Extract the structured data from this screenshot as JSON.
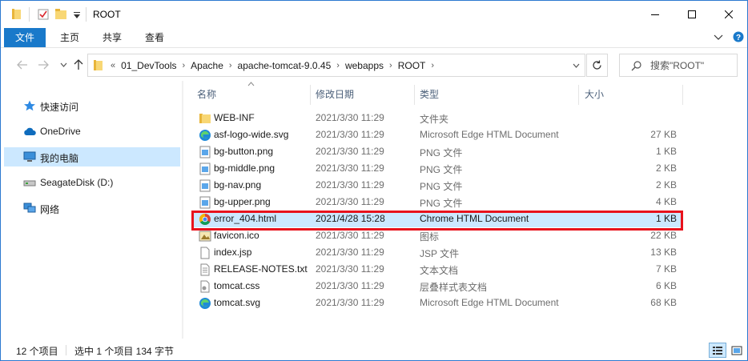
{
  "window": {
    "title": "ROOT"
  },
  "ribbon": {
    "tabs": [
      "文件",
      "主页",
      "共享",
      "查看"
    ]
  },
  "address": {
    "overflow": "«",
    "crumbs": [
      "01_DevTools",
      "Apache",
      "apache-tomcat-9.0.45",
      "webapps",
      "ROOT"
    ],
    "separator": "›"
  },
  "search": {
    "placeholder": "搜索\"ROOT\""
  },
  "nav_pane": {
    "items": [
      {
        "label": "快速访问",
        "icon": "star-icon"
      },
      {
        "label": "OneDrive",
        "icon": "cloud-icon"
      },
      {
        "label": "我的电脑",
        "icon": "computer-icon"
      },
      {
        "label": "SeagateDisk (D:)",
        "icon": "drive-icon"
      },
      {
        "label": "网络",
        "icon": "network-icon"
      }
    ],
    "selected": "我的电脑"
  },
  "columns": {
    "name": "名称",
    "date": "修改日期",
    "type": "类型",
    "size": "大小"
  },
  "files": [
    {
      "name": "WEB-INF",
      "date": "2021/3/30 11:29",
      "type": "文件夹",
      "size": "",
      "icon": "folder-icon"
    },
    {
      "name": "asf-logo-wide.svg",
      "date": "2021/3/30 11:29",
      "type": "Microsoft Edge HTML Document",
      "size": "27 KB",
      "icon": "edge-icon"
    },
    {
      "name": "bg-button.png",
      "date": "2021/3/30 11:29",
      "type": "PNG 文件",
      "size": "1 KB",
      "icon": "image-file-icon"
    },
    {
      "name": "bg-middle.png",
      "date": "2021/3/30 11:29",
      "type": "PNG 文件",
      "size": "2 KB",
      "icon": "image-file-icon"
    },
    {
      "name": "bg-nav.png",
      "date": "2021/3/30 11:29",
      "type": "PNG 文件",
      "size": "2 KB",
      "icon": "image-file-icon"
    },
    {
      "name": "bg-upper.png",
      "date": "2021/3/30 11:29",
      "type": "PNG 文件",
      "size": "4 KB",
      "icon": "image-file-icon"
    },
    {
      "name": "error_404.html",
      "date": "2021/4/28 15:28",
      "type": "Chrome HTML Document",
      "size": "1 KB",
      "icon": "chrome-icon"
    },
    {
      "name": "favicon.ico",
      "date": "2021/3/30 11:29",
      "type": "图标",
      "size": "22 KB",
      "icon": "ico-file-icon"
    },
    {
      "name": "index.jsp",
      "date": "2021/3/30 11:29",
      "type": "JSP 文件",
      "size": "13 KB",
      "icon": "blank-file-icon"
    },
    {
      "name": "RELEASE-NOTES.txt",
      "date": "2021/3/30 11:29",
      "type": "文本文档",
      "size": "7 KB",
      "icon": "text-file-icon"
    },
    {
      "name": "tomcat.css",
      "date": "2021/3/30 11:29",
      "type": "层叠样式表文档",
      "size": "6 KB",
      "icon": "css-file-icon"
    },
    {
      "name": "tomcat.svg",
      "date": "2021/3/30 11:29",
      "type": "Microsoft Edge HTML Document",
      "size": "68 KB",
      "icon": "edge-icon"
    }
  ],
  "selected_file": "error_404.html",
  "status": {
    "count": "12 个项目",
    "selection": "选中 1 个项目  134 字节"
  },
  "colors": {
    "accent": "#1979ca",
    "selection": "#cce8ff",
    "highlight": "#e8121c"
  }
}
